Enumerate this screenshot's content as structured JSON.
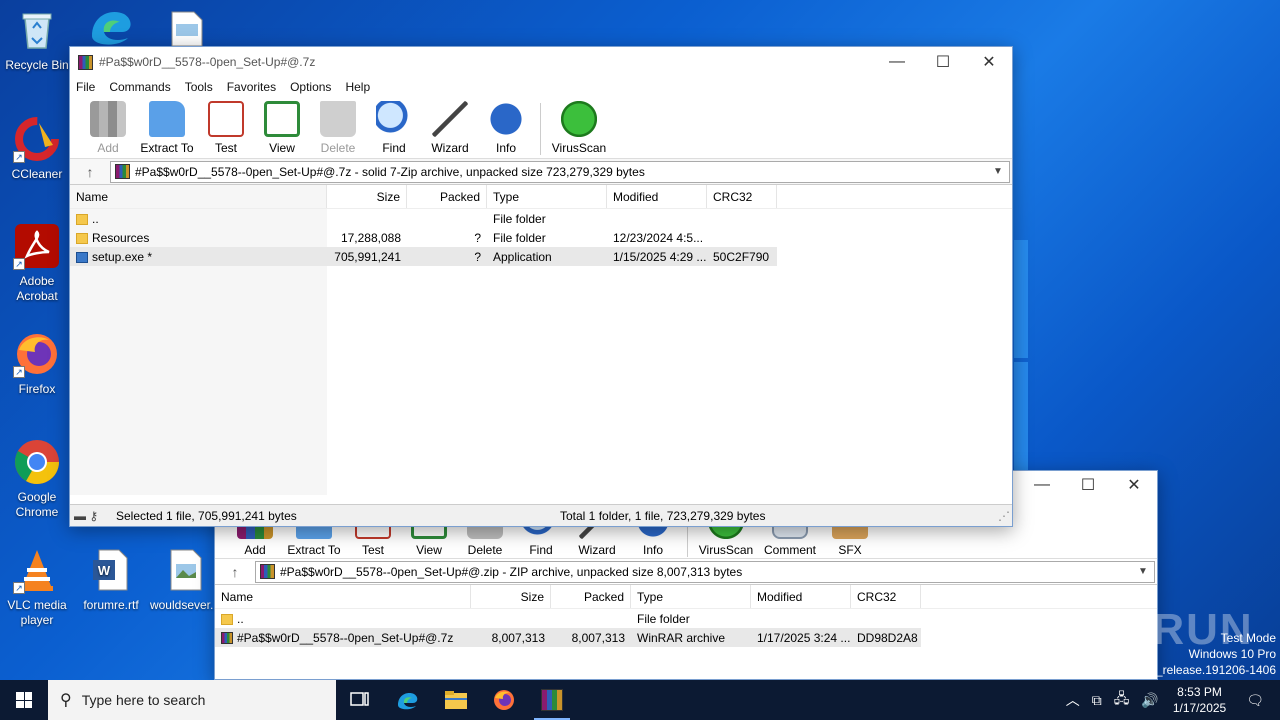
{
  "desktop": {
    "icons": [
      {
        "label": "Recycle Bin",
        "icon": "recycle-bin-icon"
      },
      {
        "label": "CCleaner",
        "icon": "ccleaner-icon"
      },
      {
        "label": "Adobe Acrobat",
        "icon": "adobe-acrobat-icon"
      },
      {
        "label": "Firefox",
        "icon": "firefox-icon"
      },
      {
        "label": "Google Chrome",
        "icon": "chrome-icon"
      },
      {
        "label": "VLC media player",
        "icon": "vlc-icon"
      },
      {
        "label": "forumre.rtf",
        "icon": "word-doc-icon"
      },
      {
        "label": "wouldsever...",
        "icon": "image-file-icon"
      }
    ],
    "watermark": {
      "brand": "ANY RUN",
      "line1": "Test Mode",
      "line2": "Windows 10 Pro",
      "line3": "b_release.191206-1406"
    }
  },
  "front_window": {
    "title": "#Pa$$w0rD__5578--0pen_Set-Up#@.7z",
    "menu": [
      "File",
      "Commands",
      "Tools",
      "Favorites",
      "Options",
      "Help"
    ],
    "toolbar": [
      "Add",
      "Extract To",
      "Test",
      "View",
      "Delete",
      "Find",
      "Wizard",
      "Info",
      "VirusScan"
    ],
    "path": "#Pa$$w0rD__5578--0pen_Set-Up#@.7z - solid 7-Zip archive, unpacked size 723,279,329 bytes",
    "columns": [
      "Name",
      "Size",
      "Packed",
      "Type",
      "Modified",
      "CRC32"
    ],
    "rows": [
      {
        "name": "..",
        "size": "",
        "packed": "",
        "type": "File folder",
        "modified": "",
        "crc": ""
      },
      {
        "name": "Resources",
        "size": "17,288,088",
        "packed": "?",
        "type": "File folder",
        "modified": "12/23/2024 4:5...",
        "crc": ""
      },
      {
        "name": "setup.exe *",
        "size": "705,991,241",
        "packed": "?",
        "type": "Application",
        "modified": "1/15/2025 4:29 ...",
        "crc": "50C2F790"
      }
    ],
    "status_left": "Selected 1 file, 705,991,241 bytes",
    "status_right": "Total 1 folder, 1 file, 723,279,329 bytes"
  },
  "back_window": {
    "toolbar": [
      "Add",
      "Extract To",
      "Test",
      "View",
      "Delete",
      "Find",
      "Wizard",
      "Info",
      "VirusScan",
      "Comment",
      "SFX"
    ],
    "path": "#Pa$$w0rD__5578--0pen_Set-Up#@.zip - ZIP archive, unpacked size 8,007,313 bytes",
    "columns": [
      "Name",
      "Size",
      "Packed",
      "Type",
      "Modified",
      "CRC32"
    ],
    "rows": [
      {
        "name": "..",
        "size": "",
        "packed": "",
        "type": "File folder",
        "modified": "",
        "crc": ""
      },
      {
        "name": "#Pa$$w0rD__5578--0pen_Set-Up#@.7z",
        "size": "8,007,313",
        "packed": "8,007,313",
        "type": "WinRAR archive",
        "modified": "1/17/2025 3:24 ...",
        "crc": "DD98D2A8"
      }
    ]
  },
  "taskbar": {
    "search_placeholder": "Type here to search",
    "time": "8:53 PM",
    "date": "1/17/2025"
  }
}
